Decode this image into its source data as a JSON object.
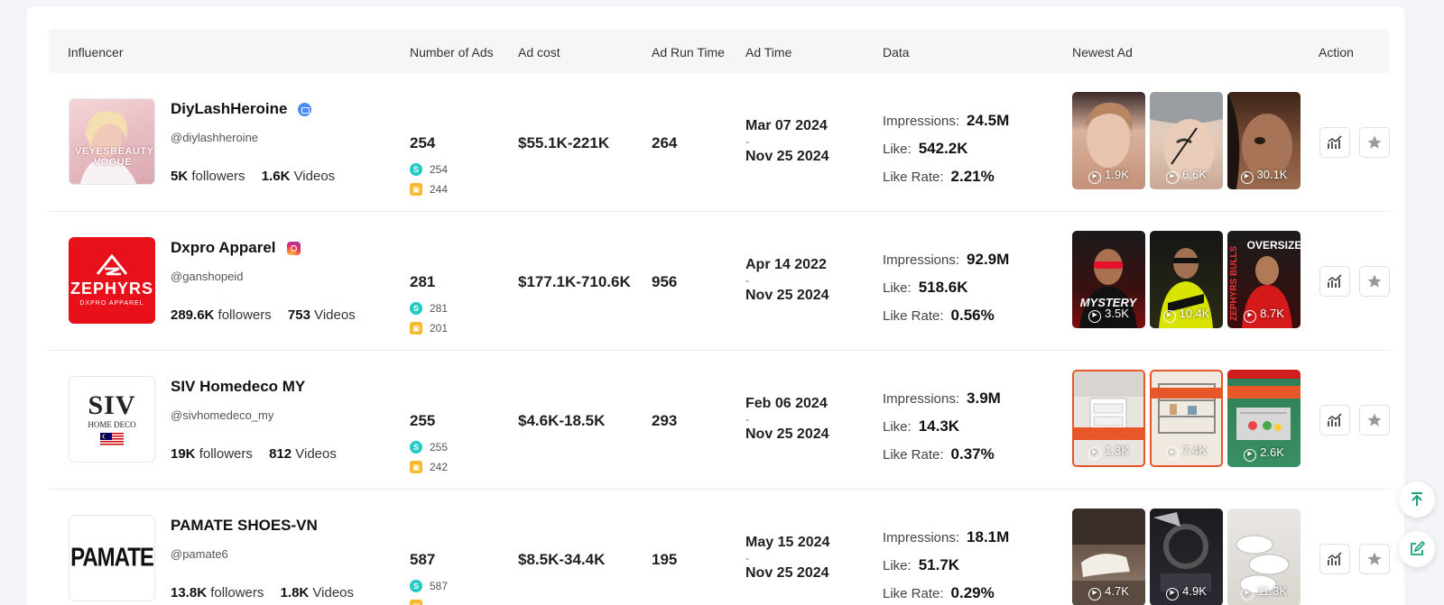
{
  "table": {
    "headers": {
      "influencer": "Influencer",
      "number_of_ads": "Number of Ads",
      "ad_cost": "Ad cost",
      "ad_run_time": "Ad Run Time",
      "ad_time": "Ad Time",
      "data": "Data",
      "newest_ad": "Newest Ad",
      "action": "Action"
    },
    "labels": {
      "followers": "followers",
      "videos": "Videos",
      "impressions": "Impressions:",
      "like": "Like:",
      "like_rate": "Like Rate:",
      "dash": "-"
    },
    "rows": [
      {
        "name": "DiyLashHeroine",
        "platform_icon": "mail-icon",
        "handle": "@diylashheroine",
        "followers": "5K",
        "videos": "1.6K",
        "ads": "254",
        "ads_s": "254",
        "ads_b": "244",
        "ad_cost": "$55.1K-221K",
        "run_time": "264",
        "start": "Mar 07 2024",
        "end": "Nov 25 2024",
        "impressions": "24.5M",
        "likes": "542.2K",
        "like_rate": "2.21%",
        "avatar_text": "VEYESBEAUTY VOGUE",
        "thumbs": [
          "1.9K",
          "6.6K",
          "30.1K"
        ]
      },
      {
        "name": "Dxpro Apparel",
        "platform_icon": "instagram-icon",
        "handle": "@ganshopeid",
        "followers": "289.6K",
        "videos": "753",
        "ads": "281",
        "ads_s": "281",
        "ads_b": "201",
        "ad_cost": "$177.1K-710.6K",
        "run_time": "956",
        "start": "Apr 14 2022",
        "end": "Nov 25 2024",
        "impressions": "92.9M",
        "likes": "518.6K",
        "like_rate": "0.56%",
        "avatar_text": "ZEPHYRS",
        "avatar_sub": "DXPRO APPAREL",
        "thumbs": [
          "3.5K",
          "10.4K",
          "8.7K"
        ]
      },
      {
        "name": "SIV Homedeco MY",
        "platform_icon": "",
        "handle": "@sivhomedeco_my",
        "followers": "19K",
        "videos": "812",
        "ads": "255",
        "ads_s": "255",
        "ads_b": "242",
        "ad_cost": "$4.6K-18.5K",
        "run_time": "293",
        "start": "Feb 06 2024",
        "end": "Nov 25 2024",
        "impressions": "3.9M",
        "likes": "14.3K",
        "like_rate": "0.37%",
        "avatar_text": "SIV",
        "avatar_sub": "HOME DECO",
        "thumbs": [
          "1.3K",
          "7.4K",
          "2.6K"
        ]
      },
      {
        "name": "PAMATE SHOES-VN",
        "platform_icon": "",
        "handle": "@pamate6",
        "followers": "13.8K",
        "videos": "1.8K",
        "ads": "587",
        "ads_s": "587",
        "ads_b": "",
        "ad_cost": "$8.5K-34.4K",
        "run_time": "195",
        "start": "May 15 2024",
        "end": "Nov 25 2024",
        "impressions": "18.1M",
        "likes": "51.7K",
        "like_rate": "0.29%",
        "avatar_text": "PAMATE",
        "thumbs": [
          "4.7K",
          "4.9K",
          "11.3K"
        ]
      }
    ]
  },
  "colors": {
    "accent_green": "#1aa37a",
    "s_badge": "#23c9c5",
    "b_badge": "#f5b82e"
  }
}
